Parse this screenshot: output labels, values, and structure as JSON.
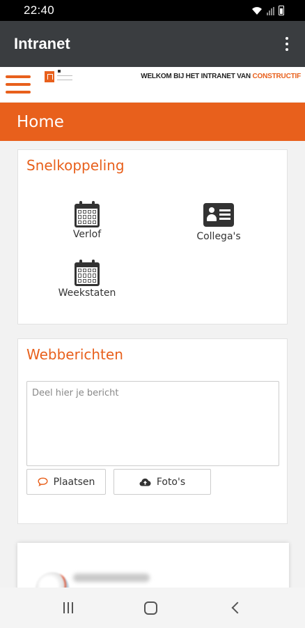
{
  "status_bar": {
    "time": "22:40"
  },
  "app_bar": {
    "title": "Intranet"
  },
  "site_header": {
    "welcome_text": "WELKOM BIJ HET INTRANET VAN ",
    "brand": "CONSTRUCTIF"
  },
  "page": {
    "title": "Home"
  },
  "snelkoppeling": {
    "title": "Snelkoppeling",
    "items": [
      {
        "label": "Verlof",
        "icon": "calendar-icon"
      },
      {
        "label": "Collega's",
        "icon": "contact-card-icon"
      },
      {
        "label": "Weekstaten",
        "icon": "calendar-icon"
      }
    ]
  },
  "webberichten": {
    "title": "Webberichten",
    "placeholder": "Deel hier je bericht",
    "post_button": "Plaatsen",
    "photo_button": "Foto's"
  },
  "colors": {
    "accent": "#e8601c",
    "app_bar": "#3a3d40"
  }
}
